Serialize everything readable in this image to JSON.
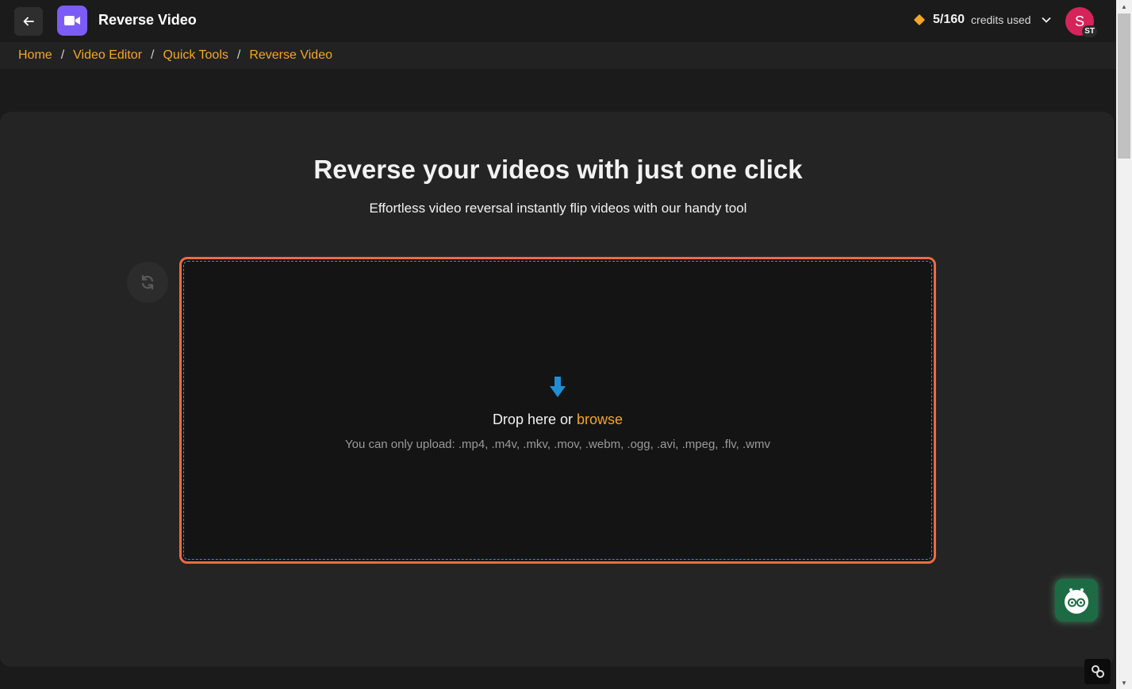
{
  "header": {
    "title": "Reverse Video",
    "credits_count": "5/160",
    "credits_label": "credits used",
    "avatar_letter": "S",
    "avatar_initials": "ST"
  },
  "breadcrumb": [
    {
      "label": "Home"
    },
    {
      "label": "Video Editor"
    },
    {
      "label": "Quick Tools"
    },
    {
      "label": "Reverse Video"
    }
  ],
  "breadcrumb_separator": "/",
  "main": {
    "heading": "Reverse your videos with just one click",
    "subheading": "Effortless video reversal instantly flip videos with our handy tool"
  },
  "dropzone": {
    "prompt": "Drop here or",
    "browse_label": "browse",
    "hint": "You can only upload: .mp4, .m4v, .mkv, .mov, .webm, .ogg, .avi, .mpeg, .flv, .wmv"
  },
  "colors": {
    "accent": "#f5a623",
    "app_icon": "#7c5cf6",
    "dropzone_border": "#ef6a43",
    "dropzone_dash": "#3b8fc5",
    "avatar": "#d6245a",
    "bot": "#1d6b44"
  },
  "icons": [
    "back-arrow-icon",
    "video-camera-icon",
    "diamond-icon",
    "chevron-down-icon",
    "refresh-icon",
    "download-arrow-icon",
    "robot-icon",
    "link-icon"
  ]
}
